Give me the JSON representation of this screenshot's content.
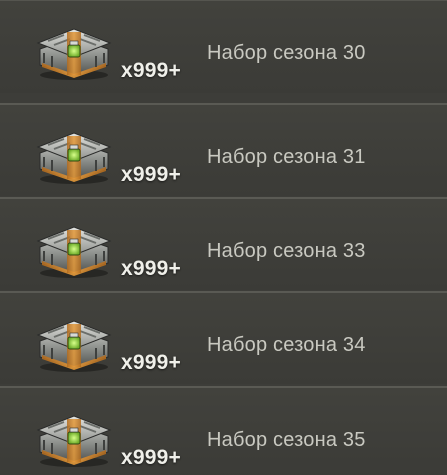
{
  "items": [
    {
      "name": "Набор сезона 30",
      "quantity": "x999+",
      "icon": "chest-icon"
    },
    {
      "name": "Набор сезона 31",
      "quantity": "x999+",
      "icon": "chest-icon"
    },
    {
      "name": "Набор сезона 33",
      "quantity": "x999+",
      "icon": "chest-icon"
    },
    {
      "name": "Набор сезона 34",
      "quantity": "x999+",
      "icon": "chest-icon"
    },
    {
      "name": "Набор сезона 35",
      "quantity": "x999+",
      "icon": "chest-icon"
    }
  ],
  "colors": {
    "background": "#3b3b37",
    "separator": "#5a5a54",
    "name_text": "#c9c9c1",
    "quantity_text": "#f0f0ea",
    "chest_accent": "#8fd64a"
  }
}
